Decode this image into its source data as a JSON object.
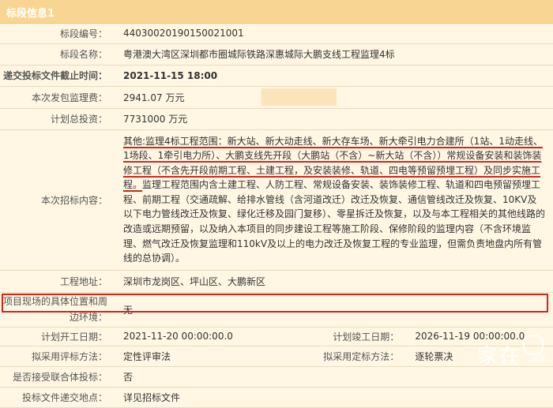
{
  "header": {
    "title": "标段信息1"
  },
  "rows": {
    "section_no": {
      "label": "标段编号：",
      "value": "44030020190150021001"
    },
    "section_name": {
      "label": "标段名称：",
      "value": "粤港澳大湾区深圳都市圈城际铁路深惠城际大鹏支线工程监理4标"
    },
    "deadline": {
      "label": "递交投标文件截止时间：",
      "value": "2021-11-15 18:00"
    },
    "fee": {
      "label": "本次发包监理费：",
      "value": "2941.07 万元"
    },
    "investment": {
      "label": "计划总投资：",
      "value": "7731000 万元"
    },
    "content": {
      "label": "本次招标内容：",
      "part1": "其他:监理4标工程范围：新大站、新大动走线、新大存车场、新大牵引电力合建所（1站、1动走线、1场段、1牵引电力所）、大鹏支线先开段（大鹏站（不含）~新大站（不含））常规设备安装和装饰装修工程（不含先开段前期工程、土建工程，及安装装修、轨道、四电等预留预埋工程）及同步实施工程。",
      "part2": "监理工程范围内含土建工程、人防工程、常规设备安装、装饰装修工程、轨道和四电预留预埋工程、前期工程（交通疏解、给排水管线（含河道改迁）改迁及恢复、通信管线改迁及恢复、10KV及以下电力管线改迁及恢复、绿化迁移及园门复移）、零星拆迁及恢复，以及与本工程相关的其他线路的改造或远期预留，以及纳入本项目的同步建设工程等施工阶段、保修阶段的监理内容（不含环境监理、燃气改迁及恢复监理和110kV及以上的电力改迁及恢复工程的专业监理，但需负责地盘内所有管线的总协调）。"
    },
    "address": {
      "label": "工程地址：",
      "value": "深圳市龙岗区、坪山区、大鹏新区"
    },
    "environment": {
      "label": "项目现场的具体位置和周边环境：",
      "value": "无"
    },
    "schedule": {
      "start_label": "计划开工日期：",
      "start_value": "2021-11-20 00:00:00.0",
      "end_label": "计划竣工日期：",
      "end_value": "2026-11-19 00:00:00.0"
    },
    "method": {
      "eval_label": "拟采用评标方法：",
      "eval_value": "定性评审法",
      "decide_label": "拟采用定标方法：",
      "decide_value": "逐轮票决"
    },
    "consortium": {
      "label": "是否接受联合体投标：",
      "value": "否"
    },
    "submit_place": {
      "label": "投标文件递交地点：",
      "value": "详见招标文件"
    }
  },
  "watermark": {
    "brand": "家在",
    "city": "深圳"
  },
  "colors": {
    "header_bg": "#f8d592",
    "panel_bg": "#fff7e3",
    "deadline": "#e0271d",
    "highlight_box": "#d6231c"
  }
}
